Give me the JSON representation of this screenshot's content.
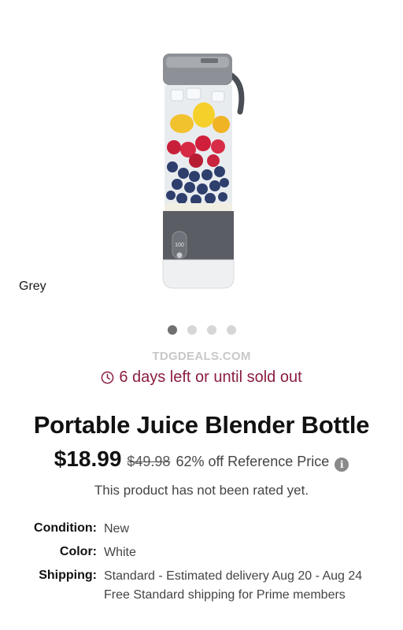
{
  "gallery": {
    "variant": "Grey",
    "dots": [
      {
        "active": true
      },
      {
        "active": false
      },
      {
        "active": false
      },
      {
        "active": false
      }
    ],
    "display_reading": "100"
  },
  "watermark": "TDGDEALS.COM",
  "deal": {
    "timer_text": "6 days left or until sold out",
    "accent": "#8b1e3f"
  },
  "product": {
    "title": "Portable Juice Blender Bottle",
    "price": "$18.99",
    "reference_price": "$49.98",
    "discount_text": "62% off Reference Price",
    "rating_text": "This product has not been rated yet."
  },
  "details": [
    {
      "label": "Condition:",
      "value": "New"
    },
    {
      "label": "Color:",
      "value": "White"
    },
    {
      "label": "Shipping:",
      "value": "Standard - Estimated delivery Aug 20 - Aug 24",
      "sub": "Free Standard shipping for Prime members"
    }
  ]
}
